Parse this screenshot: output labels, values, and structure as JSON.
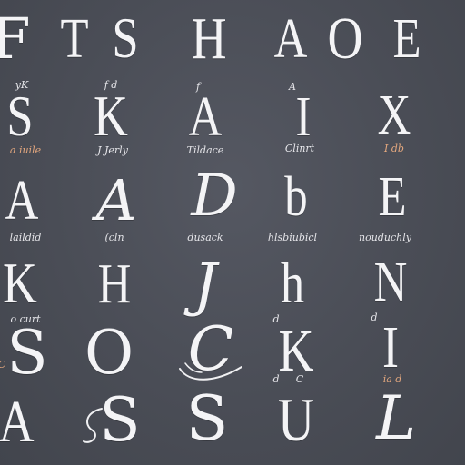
{
  "rows": [
    {
      "glyphs": [
        "F",
        "T",
        "S",
        "H",
        "A",
        "O",
        "E"
      ],
      "captions": []
    },
    {
      "glyphs": [
        "S",
        "K",
        "A",
        "I",
        "X"
      ],
      "captions": [
        "yK",
        "f d",
        "f",
        "A"
      ]
    },
    {
      "glyphs": [
        "A",
        "A",
        "D",
        "b",
        "E"
      ],
      "captions": [
        "a iuile",
        "J Jerly",
        "Tildace",
        "Clinrt",
        "I db"
      ]
    },
    {
      "glyphs": [
        "A",
        "A",
        "D",
        "b",
        "E"
      ],
      "captions": [
        "laildid",
        "(cln",
        "dusack",
        "hlsbiubicl",
        "nouduchly"
      ]
    },
    {
      "glyphs": [
        "K",
        "H",
        "J",
        "h",
        "N"
      ],
      "captions": [
        "o curt",
        "d",
        "d"
      ]
    },
    {
      "glyphs": [
        "S",
        "O",
        "C",
        "K",
        "I"
      ],
      "captions": [
        "C",
        "d",
        "C",
        "ia d"
      ]
    },
    {
      "glyphs": [
        "A",
        "S",
        "S",
        "U",
        "L"
      ],
      "captions": []
    }
  ],
  "colors": {
    "background": "#4a4d56",
    "glyph": "#f4f4f6",
    "caption_warm": "#e3a77e",
    "caption_light": "#e6e6ea"
  }
}
